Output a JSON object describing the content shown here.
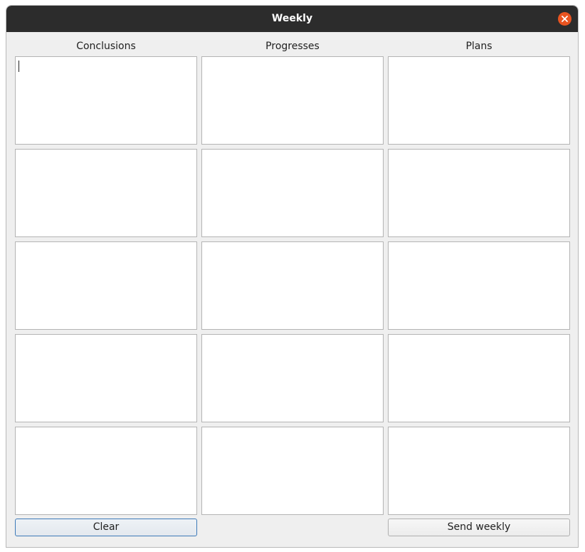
{
  "window": {
    "title": "Weekly"
  },
  "columns": [
    {
      "header": "Conclusions"
    },
    {
      "header": "Progresses"
    },
    {
      "header": "Plans"
    }
  ],
  "rows": [
    {
      "cells": [
        "",
        "",
        ""
      ]
    },
    {
      "cells": [
        "",
        "",
        ""
      ]
    },
    {
      "cells": [
        "",
        "",
        ""
      ]
    },
    {
      "cells": [
        "",
        "",
        ""
      ]
    },
    {
      "cells": [
        "",
        "",
        ""
      ]
    }
  ],
  "buttons": {
    "clear_label": "Clear",
    "send_label": "Send weekly"
  },
  "colors": {
    "titlebar": "#2c2c2c",
    "close_button": "#e95420",
    "window_bg": "#efefef",
    "focus_border": "#3d7ab8"
  },
  "icons": {
    "close": "close-icon"
  }
}
